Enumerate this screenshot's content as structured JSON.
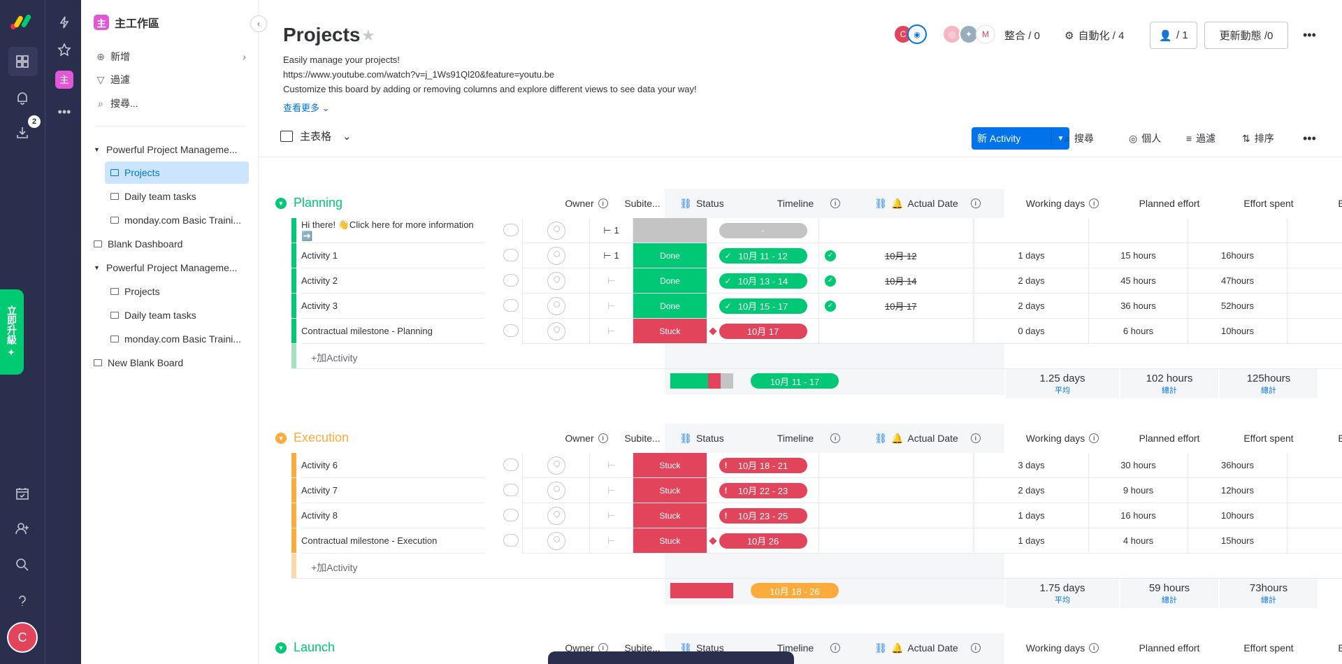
{
  "workspace": {
    "name": "主工作區",
    "badge": "主"
  },
  "rail": {
    "downloads_badge": "2",
    "upgrade_label": "立即升級 ✦",
    "user_initial": "C"
  },
  "sidebar": {
    "add_label": "新增",
    "filter_label": "過濾",
    "search_label": "搜尋...",
    "items": [
      {
        "label": "Powerful Project Manageme...",
        "type": "folder"
      },
      {
        "label": "Projects",
        "type": "board",
        "selected": true
      },
      {
        "label": "Daily team tasks",
        "type": "board"
      },
      {
        "label": "monday.com Basic Traini...",
        "type": "board"
      },
      {
        "label": "Blank Dashboard",
        "type": "dashboard"
      },
      {
        "label": "Powerful Project Manageme...",
        "type": "folder"
      },
      {
        "label": "Projects",
        "type": "board"
      },
      {
        "label": "Daily team tasks",
        "type": "board"
      },
      {
        "label": "monday.com Basic Traini...",
        "type": "board"
      },
      {
        "label": "New Blank Board",
        "type": "board"
      }
    ]
  },
  "header": {
    "title": "Projects",
    "desc_line1": "Easily manage your projects!",
    "desc_line2": "https://www.youtube.com/watch?v=j_1Ws91Ql20&feature=youtu.be",
    "desc_line3": "Customize this board by adding or removing columns and explore different views to see data your way!",
    "see_more": "查看更多",
    "integrate": "整合 / 0",
    "automate": "自動化 / 4",
    "members": "/ 1",
    "activity": "更新動態 /0",
    "owner_initial": "C"
  },
  "toolbar": {
    "view": "主表格",
    "new_item": "新 Activity",
    "search": "搜尋",
    "person": "個人",
    "filter": "過濾",
    "sort": "排序"
  },
  "columns": {
    "owner": "Owner",
    "subitems": "Subite...",
    "status": "Status",
    "timeline": "Timeline",
    "actual": "Actual Date",
    "working": "Working days",
    "planned": "Planned effort",
    "spent": "Effort spent",
    "extra": "E"
  },
  "colors": {
    "done": "#00c875",
    "stuck": "#e2445c",
    "empty": "#c4c4c4",
    "planning": "#00c875",
    "execution": "#fdab3d",
    "launch": "#00c875",
    "accent": "#0073ea"
  },
  "groups": [
    {
      "name": "Planning",
      "add_label": "+加Activity",
      "rows": [
        {
          "name": "Hi there! 👋Click here for more information ➡️",
          "subitems": "1",
          "status": "",
          "timeline": "-",
          "actual": "",
          "working": "",
          "planned": "",
          "spent": ""
        },
        {
          "name": "Activity 1",
          "subitems": "1",
          "status": "Done",
          "timeline": "10月 11 - 12",
          "actual": "10月 12",
          "working": "1 days",
          "planned": "15 hours",
          "spent": "16hours"
        },
        {
          "name": "Activity 2",
          "subitems": "",
          "status": "Done",
          "timeline": "10月 13 - 14",
          "actual": "10月 14",
          "working": "2 days",
          "planned": "45 hours",
          "spent": "47hours"
        },
        {
          "name": "Activity 3",
          "subitems": "",
          "status": "Done",
          "timeline": "10月 15 - 17",
          "actual": "10月 17",
          "working": "2 days",
          "planned": "36 hours",
          "spent": "52hours"
        },
        {
          "name": "Contractual milestone - Planning",
          "subitems": "",
          "status": "Stuck",
          "timeline": "10月 17",
          "actual": "",
          "working": "0 days",
          "planned": "6 hours",
          "spent": "10hours"
        }
      ],
      "summary": {
        "timeline": "10月 11 - 17",
        "working": "1.25 days",
        "working_sub": "平均",
        "planned": "102 hours",
        "planned_sub": "總計",
        "spent": "125hours",
        "spent_sub": "總計"
      }
    },
    {
      "name": "Execution",
      "add_label": "+加Activity",
      "rows": [
        {
          "name": "Activity 6",
          "subitems": "",
          "status": "Stuck",
          "timeline": "10月 18 - 21",
          "actual": "",
          "working": "3 days",
          "planned": "30 hours",
          "spent": "36hours"
        },
        {
          "name": "Activity 7",
          "subitems": "",
          "status": "Stuck",
          "timeline": "10月 22 - 23",
          "actual": "",
          "working": "2 days",
          "planned": "9 hours",
          "spent": "12hours"
        },
        {
          "name": "Activity 8",
          "subitems": "",
          "status": "Stuck",
          "timeline": "10月 23 - 25",
          "actual": "",
          "working": "1 days",
          "planned": "16 hours",
          "spent": "10hours"
        },
        {
          "name": "Contractual milestone - Execution",
          "subitems": "",
          "status": "Stuck",
          "timeline": "10月 26",
          "actual": "",
          "working": "1 days",
          "planned": "4 hours",
          "spent": "15hours"
        }
      ],
      "summary": {
        "timeline": "10月 18 - 26",
        "working": "1.75 days",
        "working_sub": "平均",
        "planned": "59 hours",
        "planned_sub": "總計",
        "spent": "73hours",
        "spent_sub": "總計"
      }
    },
    {
      "name": "Launch"
    }
  ]
}
